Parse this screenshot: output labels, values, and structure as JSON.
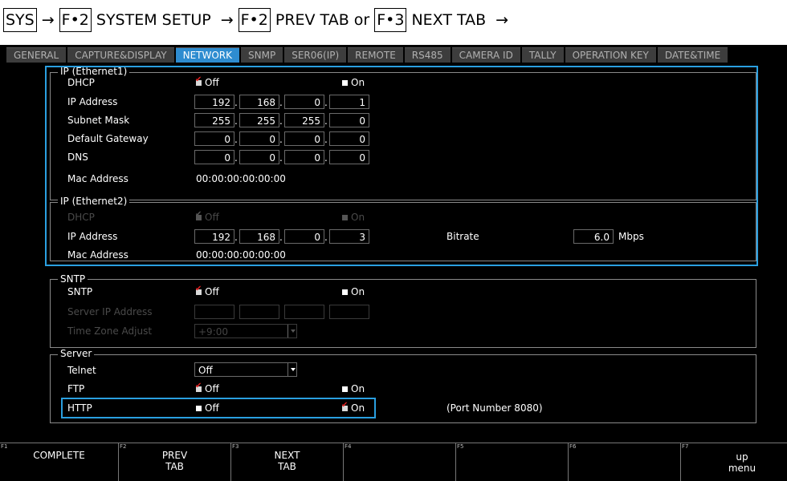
{
  "breadcrumb": {
    "sys": "SYS",
    "arrow": "→",
    "f2a": "F•2",
    "system_setup": "SYSTEM SETUP",
    "f2b": "F•2",
    "prev_tab": "PREV TAB or",
    "f3": "F•3",
    "next_tab": "NEXT TAB"
  },
  "tabs": [
    "GENERAL",
    "CAPTURE&DISPLAY",
    "NETWORK",
    "SNMP",
    "SER06(IP)",
    "REMOTE",
    "RS485",
    "CAMERA ID",
    "TALLY",
    "OPERATION KEY",
    "DATE&TIME"
  ],
  "active_tab": "NETWORK",
  "eth1": {
    "title": "IP (Ethernet1)",
    "dhcp_label": "DHCP",
    "dhcp_off": "Off",
    "dhcp_on": "On",
    "ip_label": "IP Address",
    "ip": [
      "192",
      "168",
      "0",
      "1"
    ],
    "subnet_label": "Subnet Mask",
    "subnet": [
      "255",
      "255",
      "255",
      "0"
    ],
    "gateway_label": "Default Gateway",
    "gateway": [
      "0",
      "0",
      "0",
      "0"
    ],
    "dns_label": "DNS",
    "dns": [
      "0",
      "0",
      "0",
      "0"
    ],
    "mac_label": "Mac Address",
    "mac": "00:00:00:00:00:00"
  },
  "eth2": {
    "title": "IP (Ethernet2)",
    "dhcp_label": "DHCP",
    "dhcp_off": "Off",
    "dhcp_on": "On",
    "ip_label": "IP Address",
    "ip": [
      "192",
      "168",
      "0",
      "3"
    ],
    "bitrate_label": "Bitrate",
    "bitrate": "6.0",
    "bitrate_unit": "Mbps",
    "mac_label": "Mac Address",
    "mac": "00:00:00:00:00:00"
  },
  "sntp": {
    "title": "SNTP",
    "sntp_label": "SNTP",
    "sntp_off": "Off",
    "sntp_on": "On",
    "server_label": "Server IP Address",
    "tz_label": "Time Zone Adjust",
    "tz_value": "+9:00"
  },
  "server": {
    "title": "Server",
    "telnet_label": "Telnet",
    "telnet_value": "Off",
    "ftp_label": "FTP",
    "ftp_off": "Off",
    "ftp_on": "On",
    "http_label": "HTTP",
    "http_off": "Off",
    "http_on": "On",
    "port_note": "(Port Number 8080)"
  },
  "fkeys": [
    {
      "num": "F1",
      "label": "COMPLETE"
    },
    {
      "num": "F2",
      "label": "PREV\nTAB"
    },
    {
      "num": "F3",
      "label": "NEXT\nTAB"
    },
    {
      "num": "F4",
      "label": ""
    },
    {
      "num": "F5",
      "label": ""
    },
    {
      "num": "F6",
      "label": ""
    },
    {
      "num": "F7",
      "label": "up\nmenu"
    }
  ],
  "colors": {
    "accent": "#2a9fe0",
    "active_tab": "#2e8cd0",
    "check": "#e02020"
  }
}
